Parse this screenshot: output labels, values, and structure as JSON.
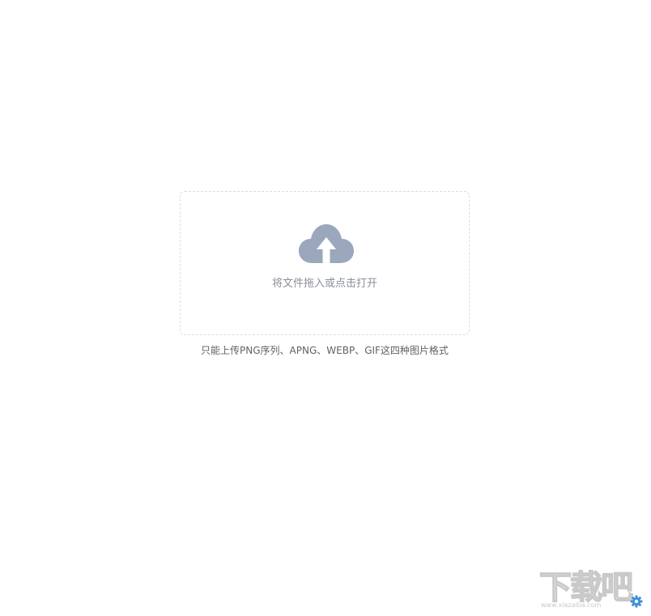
{
  "upload": {
    "prompt": "将文件拖入或点击打开",
    "tip": "只能上传PNG序列、APNG、WEBP、GIF这四种图片格式",
    "icon": "cloud-upload-icon",
    "icon_color": "#9aa7bd"
  },
  "watermark": {
    "text": "下载吧",
    "url": "www.xiazaiba.com",
    "icon": "gear-icon",
    "icon_color": "#3b8fd9"
  }
}
